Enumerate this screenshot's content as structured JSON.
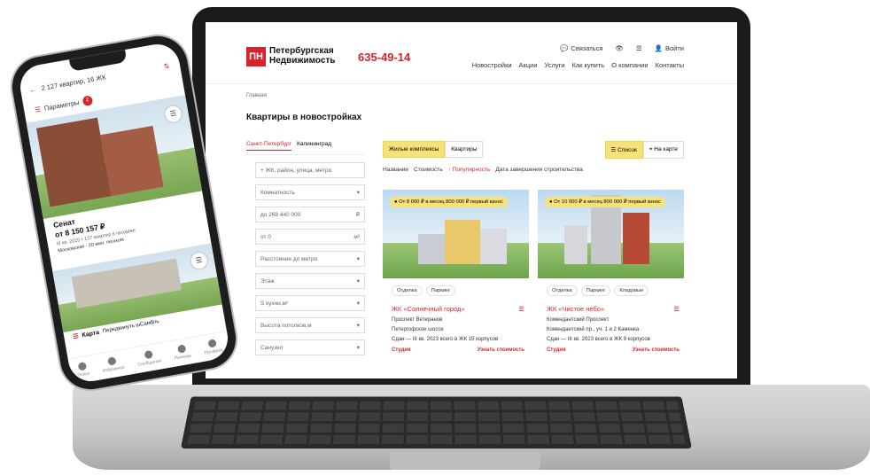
{
  "laptop": {
    "header": {
      "logo_mark": "ПН",
      "logo_text": "Петербургская Недвижимость",
      "phone": "635-49-14",
      "contact": "Связаться",
      "login": "Войти",
      "menu": [
        "Новостройки",
        "Акции",
        "Услуги",
        "Как купить",
        "О компании",
        "Контакты"
      ]
    },
    "breadcrumb": "Главная",
    "title": "Квартиры в новостройках",
    "filters": {
      "cities": [
        "Санкт-Петербург",
        "Калининград"
      ],
      "fields": [
        {
          "label": "+ ЖК, район, улица, метро",
          "suffix": ""
        },
        {
          "label": "Комнатность",
          "suffix": "▾"
        },
        {
          "label": "до  268 440 000",
          "suffix": "₽"
        },
        {
          "label": "от  0",
          "suffix": "м²"
        },
        {
          "label": "Расстояние до метро",
          "suffix": "▾"
        },
        {
          "label": "Этаж",
          "suffix": "▾"
        },
        {
          "label": "S кухни,м²",
          "suffix": "▾"
        },
        {
          "label": "Высота потолков,м",
          "suffix": "▾"
        },
        {
          "label": "Санузел",
          "suffix": "▾"
        }
      ]
    },
    "content": {
      "segments": [
        "Жилые комплексы",
        "Квартиры"
      ],
      "views": [
        "Список",
        "На карте"
      ],
      "sort": [
        "Название",
        "Стоимость",
        "Популярность",
        "Дата завершения строительства"
      ],
      "cards": [
        {
          "promo": "От 8 000 ₽ в месяц 800 000 ₽ первый взнос",
          "chips": [
            "Отделка",
            "Паркинг"
          ],
          "name": "ЖК «Солнечный город»",
          "metro": "Проспект Ветеранов",
          "address": "Петергофское шоссе",
          "deadline": "Сдан — III кв. 2023  всего в ЖК 15 корпусов",
          "type": "Студия",
          "cta": "Узнать стоимость"
        },
        {
          "promo": "От 10 000 ₽ в месяц 800 000 ₽ первый взнос",
          "chips": [
            "Отделка",
            "Паркинг",
            "Кладовые"
          ],
          "name": "ЖК «Чистое небо»",
          "metro": "Комендантский Проспект",
          "address": "Комендантский пр., уч. 1 и 2 Каменка",
          "deadline": "Сдан — III кв. 2023  всего в ЖК 9 корпусов",
          "type": "Студия",
          "cta": "Узнать стоимость"
        }
      ]
    }
  },
  "phone": {
    "top": "2 127 квартир, 16 ЖК",
    "params": "Параметры",
    "params_count": "2",
    "card": {
      "name": "Сенат",
      "price": "от 8 150 157 ₽",
      "sub": "III кв. 2025 • 127 квартир в продаже",
      "metro": "Московская  ·  20 мин. пешком"
    },
    "map": "Карта",
    "map_sub": "Передвинуть шСамбль",
    "nav": [
      "Поиск",
      "Избранное",
      "Сообщения",
      "Помощь",
      "Профиль"
    ]
  }
}
